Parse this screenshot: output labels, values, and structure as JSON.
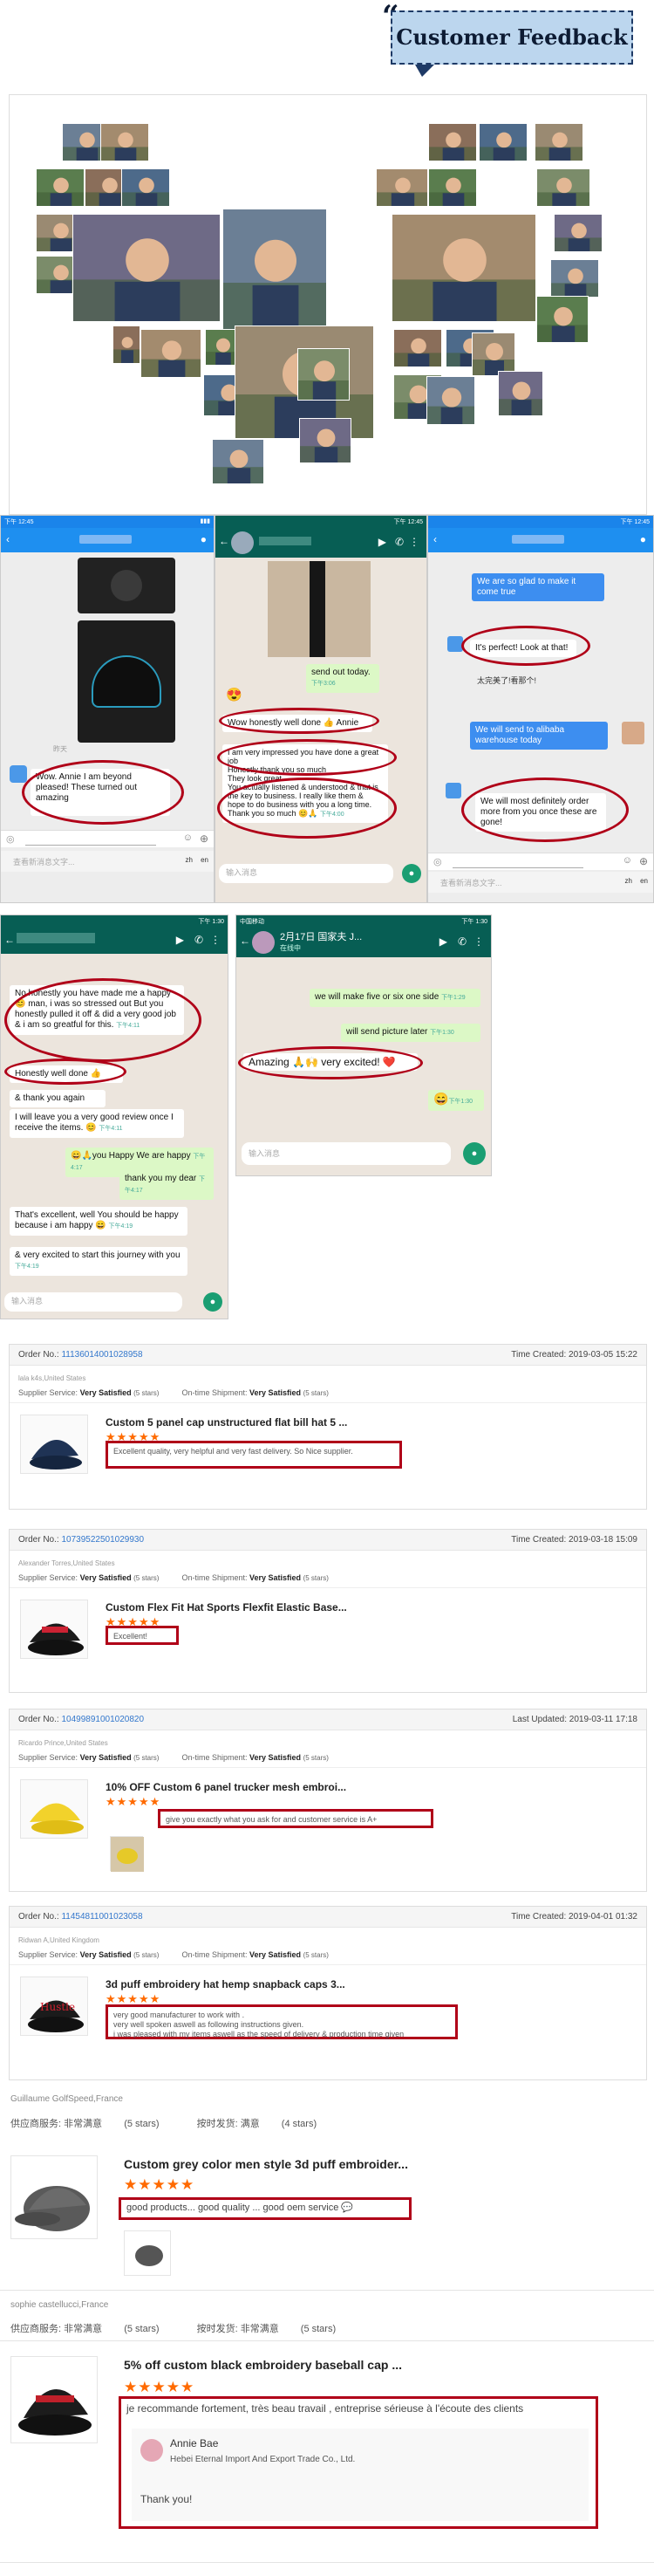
{
  "header": {
    "title": "Customer Feedback"
  },
  "chats": {
    "c1": {
      "b1": "Wow. Annie I am beyond pleased! These turned out amazing",
      "input_placeholder": "查看新消息文字..."
    },
    "c2": {
      "b1": "send out today.",
      "b1_time": "下午3:06",
      "b2": "Wow honestly well done 👍 Annie",
      "b3": "I am very impressed you have done a great job",
      "b4": "Honestly thank you so much",
      "b5": "They look great",
      "b6": "You actually listened & understood & that is the key to business. I really like them & hope to do business with you a long time.",
      "b7": "Thank you so much 😊🙏",
      "b7_time": "下午4:00",
      "input_placeholder": "输入消息"
    },
    "c3": {
      "b1": "We are so glad to make it come true",
      "b2": "It's perfect! Look at that!",
      "b3": "太完美了!看那个!",
      "b4": "We will send to alibaba warehouse today",
      "b5": "We will most definitely order more from you once these are gone!",
      "input_placeholder": "查看新消息文字..."
    },
    "c4": {
      "b1": "No honestly you have made me a happy 😊 man, i was so stressed out But you honestly pulled it off & did a very good job & i am so greatful for this.",
      "b1_time": "下午4:11",
      "b2": "Honestly well done 👍",
      "b3": "& thank you again",
      "b4": "I will leave you a very good review once I receive the items. 😊",
      "b4_time": "下午4:11",
      "b5": "😄🙏you Happy We are happy",
      "b5_time": "下午4:17",
      "b6": "thank you my dear",
      "b6_time": "下午4:17",
      "b7": "That's excellent, well You should be happy because i am happy 😄",
      "b7_time": "下午4:19",
      "b8": "& very excited to start this journey with you",
      "b8_time": "下午4:19",
      "input_placeholder": "输入消息"
    },
    "c5": {
      "status": "中国移动",
      "title": "2月17日 国家夫 J...",
      "subtitle": "在线中",
      "b1": "we will make five or six one side",
      "b1_time": "下午1:29",
      "b2": "will send picture later",
      "b2_time": "下午1:30",
      "b3": "Amazing 🙏🙌 very excited! ❤️",
      "b4": "😄",
      "b4_time": "下午1:30",
      "input_placeholder": "输入消息"
    },
    "common": {
      "time_a": "下午 12:45",
      "time_b": "下午 1:30",
      "send": "zh",
      "send2": "en"
    }
  },
  "orders": [
    {
      "order_label": "Order No.:",
      "order_no": "111360140010289​58",
      "time_label": "Time Created:",
      "time": "2019-03-05 15:22",
      "buyer": "lala k4s,United States",
      "supplier_label": "Supplier Service:",
      "supplier_val": "Very Satisfied",
      "supplier_stars": "(5 stars)",
      "ship_label": "On-time Shipment:",
      "ship_val": "Very Satisfied",
      "ship_stars": "(5 stars)",
      "product": "Custom 5 panel cap unstructured flat bill hat 5 ...",
      "rating": "★★★★★",
      "review": "Excellent quality, very helpful and very fast delivery. So Nice supplier."
    },
    {
      "order_label": "Order No.:",
      "order_no": "107395225010299​30",
      "time_label": "Time Created:",
      "time": "2019-03-18 15:09",
      "buyer": "Alexander Torres,United States",
      "supplier_label": "Supplier Service:",
      "supplier_val": "Very Satisfied",
      "supplier_stars": "(5 stars)",
      "ship_label": "On-time Shipment:",
      "ship_val": "Very Satisfied",
      "ship_stars": "(5 stars)",
      "product": "Custom Flex Fit Hat Sports Flexfit Elastic Base...",
      "rating": "★★★★★",
      "review": "Excellent!"
    },
    {
      "order_label": "Order No.:",
      "order_no": "104998910010​20820",
      "time_label": "Last Updated:",
      "time": "2019-03-11 17:18",
      "buyer": "Ricardo Prince,United States",
      "supplier_label": "Supplier Service:",
      "supplier_val": "Very Satisfied",
      "supplier_stars": "(5 stars)",
      "ship_label": "On-time Shipment:",
      "ship_val": "Very Satisfied",
      "ship_stars": "(5 stars)",
      "product": "10% OFF Custom 6 panel trucker mesh embroi...",
      "rating": "★★★★★",
      "review": "give you exactly what you ask for and customer service is A+"
    },
    {
      "order_label": "Order No.:",
      "order_no": "114548110010​23058",
      "time_label": "Time Created:",
      "time": "2019-04-01 01:32",
      "buyer": "Ridwan A,United Kingdom",
      "supplier_label": "Supplier Service:",
      "supplier_val": "Very Satisfied",
      "supplier_stars": "(5 stars)",
      "ship_label": "On-time Shipment:",
      "ship_val": "Very Satisfied",
      "ship_stars": "(5 stars)",
      "product": "3d puff embroidery hat hemp snapback caps 3...",
      "rating": "★★★★★",
      "review": "very good manufacturer to work with .\nvery well spoken aswell as following instructions given.\ni was pleased with my items aswell as the speed of delivery & production time given"
    }
  ],
  "reviews": [
    {
      "buyer": "Guillaume GolfSpeed,France",
      "supplier_label": "供应商服务:",
      "supplier_val": "非常满意",
      "supplier_stars": "(5 stars)",
      "ship_label": "按时发货:",
      "ship_val": "满意",
      "ship_stars": "(4 stars)",
      "product": "Custom grey color men style 3d puff embroider...",
      "rating": "★★★★★",
      "review": "good products... good quality ... good oem service 💬"
    },
    {
      "buyer": "sophie castellucci,France",
      "supplier_label": "供应商服务:",
      "supplier_val": "非常满意",
      "supplier_stars": "(5 stars)",
      "ship_label": "按时发货:",
      "ship_val": "非常满意",
      "ship_stars": "(5 stars)",
      "product": "5% off custom black embroidery baseball cap ...",
      "rating": "★★★★★",
      "review": "je recommande fortement, très beau travail , entreprise sérieuse à l'écoute des clients",
      "reply_name": "Annie Bae",
      "reply_company": "Hebei Eternal Import And Export Trade Co., Ltd.",
      "reply_text": "Thank you!"
    }
  ]
}
